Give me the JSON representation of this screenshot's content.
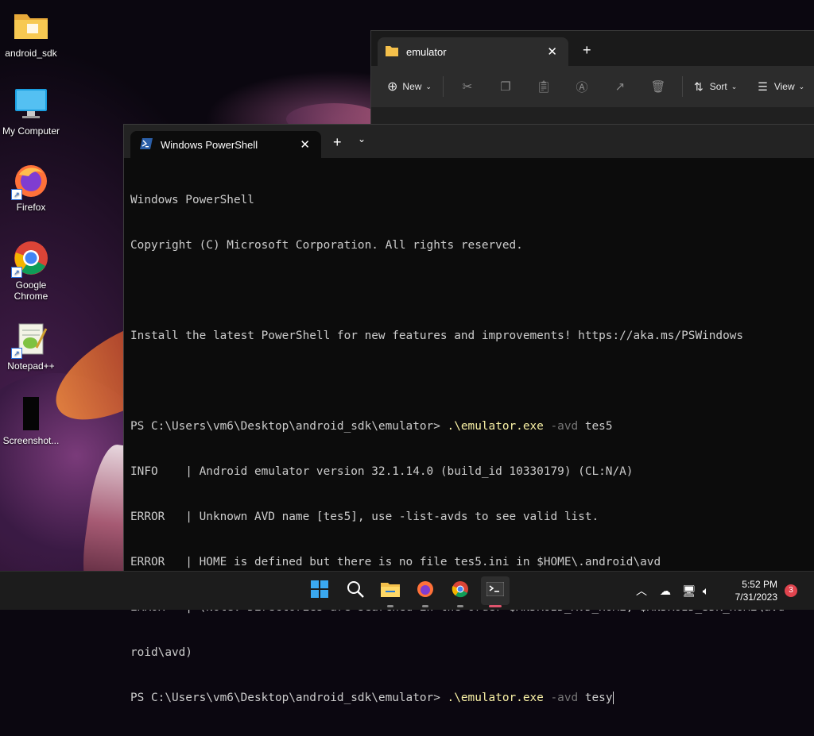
{
  "desktop": {
    "icons": [
      {
        "label": "android_sdk",
        "icon": "folder-icon"
      },
      {
        "label": "My Computer",
        "icon": "monitor-icon"
      },
      {
        "label": "Firefox",
        "icon": "firefox-icon"
      },
      {
        "label": "Google Chrome",
        "icon": "chrome-icon"
      },
      {
        "label": "Notepad++",
        "icon": "notepadpp-icon"
      },
      {
        "label": "Screenshot...",
        "icon": "screenshot-icon"
      }
    ]
  },
  "explorer": {
    "tab_title": "emulator",
    "toolbar": {
      "new_label": "New",
      "sort_label": "Sort",
      "view_label": "View"
    }
  },
  "powershell": {
    "tab_title": "Windows PowerShell",
    "lines": [
      "Windows PowerShell",
      "Copyright (C) Microsoft Corporation. All rights reserved.",
      "",
      "Install the latest PowerShell for new features and improvements! https://aka.ms/PSWindows",
      "",
      "PS C:\\Users\\vm6\\Desktop\\android_sdk\\emulator> ",
      "INFO    | Android emulator version 32.1.14.0 (build_id 10330179) (CL:N/A)",
      "ERROR   | Unknown AVD name [tes5], use -list-avds to see valid list.",
      "ERROR   | HOME is defined but there is no file tes5.ini in $HOME\\.android\\avd",
      "ERROR   | (Note: Directories are searched in the order $ANDROID_AVD_HOME, $ANDROID_SDK_HOME\\avd",
      "roid\\avd)",
      "PS C:\\Users\\vm6\\Desktop\\android_sdk\\emulator> "
    ],
    "cmd1": {
      "exe": ".\\emulator.exe",
      "flag": "-avd",
      "value": " tes5"
    },
    "cmd2": {
      "exe": ".\\emulator.exe",
      "flag": "-avd",
      "value": " tesy"
    }
  },
  "taskbar": {
    "apps": [
      "start-icon",
      "search-icon",
      "file-explorer-icon",
      "firefox-icon",
      "chrome-icon",
      "terminal-icon"
    ],
    "time": "5:52 PM",
    "date": "7/31/2023",
    "notification_count": "3"
  },
  "colors": {
    "accent_exe": "#f9f1a5",
    "flag_gray": "#767676",
    "badge_red": "#e0444e"
  }
}
